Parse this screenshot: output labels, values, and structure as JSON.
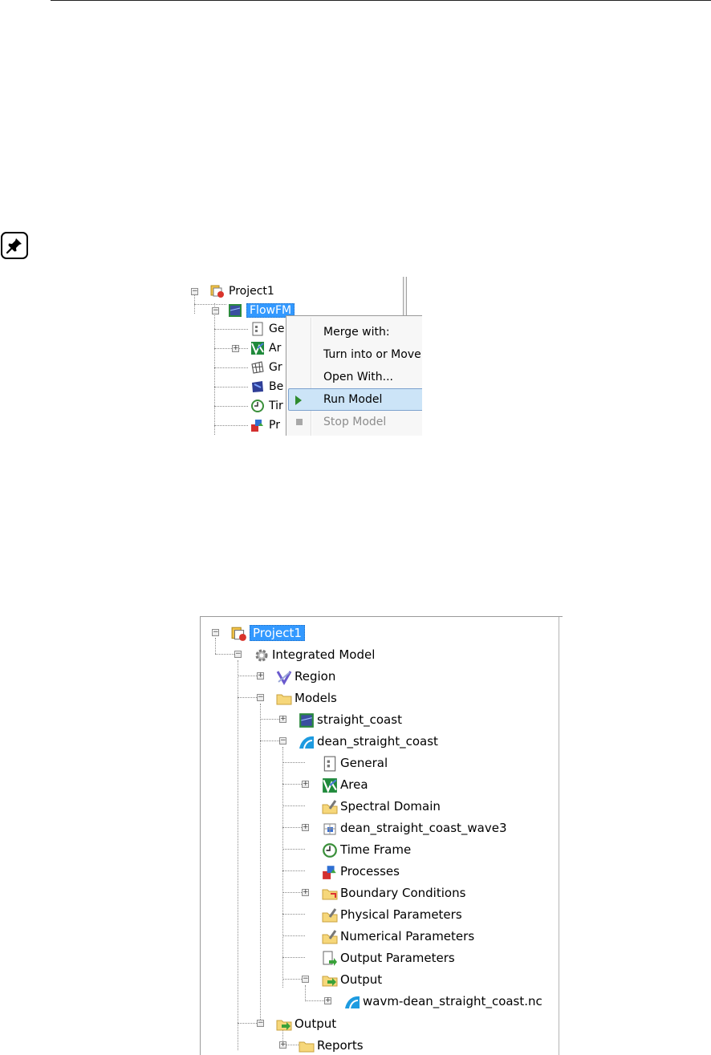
{
  "shot1": {
    "tree": [
      {
        "label": "Project1",
        "icon": "project-icon"
      },
      {
        "label": "FlowFM",
        "icon": "flowfm-model-icon",
        "selected": true
      },
      {
        "label": "Ge",
        "icon": "general-icon"
      },
      {
        "label": "Ar",
        "icon": "area-icon"
      },
      {
        "label": "Gr",
        "icon": "grid-icon"
      },
      {
        "label": "Be",
        "icon": "bed-level-icon"
      },
      {
        "label": "Tir",
        "icon": "time-frame-icon"
      },
      {
        "label": "Pr",
        "icon": "processes-icon"
      }
    ],
    "menu": [
      {
        "label": "Merge with:"
      },
      {
        "label": "Turn into or Move to Integrated Model",
        "submenu": true
      },
      {
        "label": "Open With..."
      },
      {
        "label": "Run Model",
        "highlighted": true,
        "icon": "play-icon"
      },
      {
        "label": "Stop Model",
        "disabled": true,
        "icon": "stop-icon"
      }
    ]
  },
  "shot2": {
    "tree": [
      {
        "label": "Project1",
        "icon": "project-icon",
        "selected": true
      },
      {
        "label": "Integrated Model",
        "icon": "gear-icon"
      },
      {
        "label": "Region",
        "icon": "region-icon"
      },
      {
        "label": "Models",
        "icon": "folder-icon"
      },
      {
        "label": "straight_coast",
        "icon": "flowfm-model-icon"
      },
      {
        "label": "dean_straight_coast",
        "icon": "wave-icon"
      },
      {
        "label": "General",
        "icon": "general-icon"
      },
      {
        "label": "Area",
        "icon": "area-icon"
      },
      {
        "label": "Spectral Domain",
        "icon": "folder-edit-icon"
      },
      {
        "label": "dean_straight_coast_wave3",
        "icon": "grid-icon"
      },
      {
        "label": "Time Frame",
        "icon": "time-frame-icon"
      },
      {
        "label": "Processes",
        "icon": "processes-icon"
      },
      {
        "label": "Boundary Conditions",
        "icon": "boundary-folder-icon"
      },
      {
        "label": "Physical Parameters",
        "icon": "folder-edit-icon"
      },
      {
        "label": "Numerical Parameters",
        "icon": "folder-edit-icon"
      },
      {
        "label": "Output Parameters",
        "icon": "output-params-icon"
      },
      {
        "label": "Output",
        "icon": "output-folder-icon"
      },
      {
        "label": "wavm-dean_straight_coast.nc",
        "icon": "wave-icon"
      },
      {
        "label": "Output",
        "icon": "output-folder-icon"
      },
      {
        "label": "Reports",
        "icon": "folder-icon"
      }
    ]
  },
  "colors": {
    "selection": "#3399ff",
    "menu_highlight": "#cce4f7",
    "run_green": "#2e8b2e"
  }
}
